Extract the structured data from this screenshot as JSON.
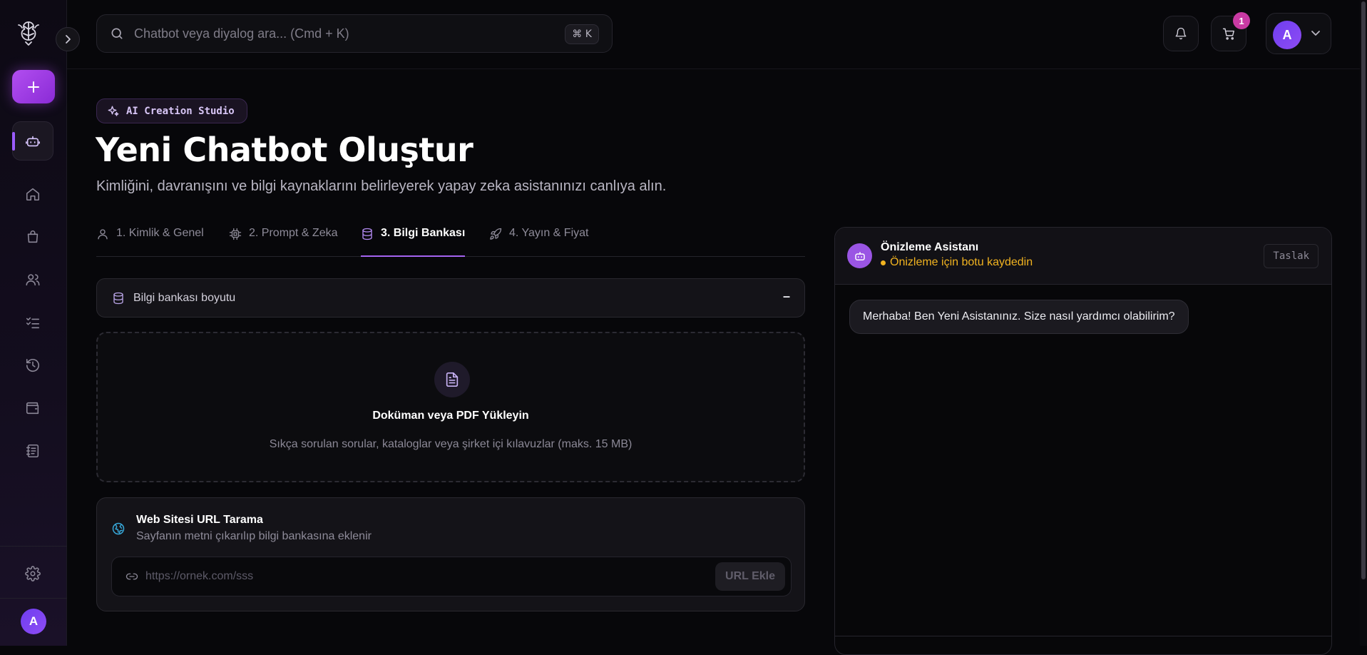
{
  "search": {
    "placeholder": "Chatbot veya diyalog ara... (Cmd + K)",
    "shortcut": "⌘ K"
  },
  "cart": {
    "count": "1"
  },
  "user": {
    "initial": "A"
  },
  "page": {
    "badge": "AI Creation Studio",
    "title": "Yeni Chatbot Oluştur",
    "subtitle": "Kimliğini, davranışını ve bilgi kaynaklarını belirleyerek yapay zeka asistanınızı canlıya alın."
  },
  "tabs": [
    {
      "label": "1. Kimlik & Genel",
      "icon": "user-icon",
      "active": false
    },
    {
      "label": "2. Prompt & Zeka",
      "icon": "cpu-icon",
      "active": false
    },
    {
      "label": "3. Bilgi Bankası",
      "icon": "database-icon",
      "active": true
    },
    {
      "label": "4. Yayın & Fiyat",
      "icon": "rocket-icon",
      "active": false
    }
  ],
  "knowledge": {
    "size_label": "Bilgi bankası boyutu",
    "size_value": "–"
  },
  "upload": {
    "heading": "Doküman veya PDF Yükleyin",
    "hint": "Sıkça sorulan sorular, kataloglar veya şirket içi kılavuzlar (maks. 15 MB)"
  },
  "url_scan": {
    "heading": "Web Sitesi URL Tarama",
    "hint": "Sayfanın metni çıkarılıp bilgi bankasına eklenir",
    "placeholder": "https://ornek.com/sss",
    "button": "URL Ekle"
  },
  "preview": {
    "name": "Önizleme Asistanı",
    "status": "Önizleme için botu kaydedin",
    "draft_badge": "Taslak",
    "greeting": "Merhaba! Ben Yeni Asistanınız. Size nasıl yardımcı olabilirim?"
  },
  "colors": {
    "accent": "#a463f0",
    "warning": "#f1b320",
    "link": "#37a7d8"
  }
}
